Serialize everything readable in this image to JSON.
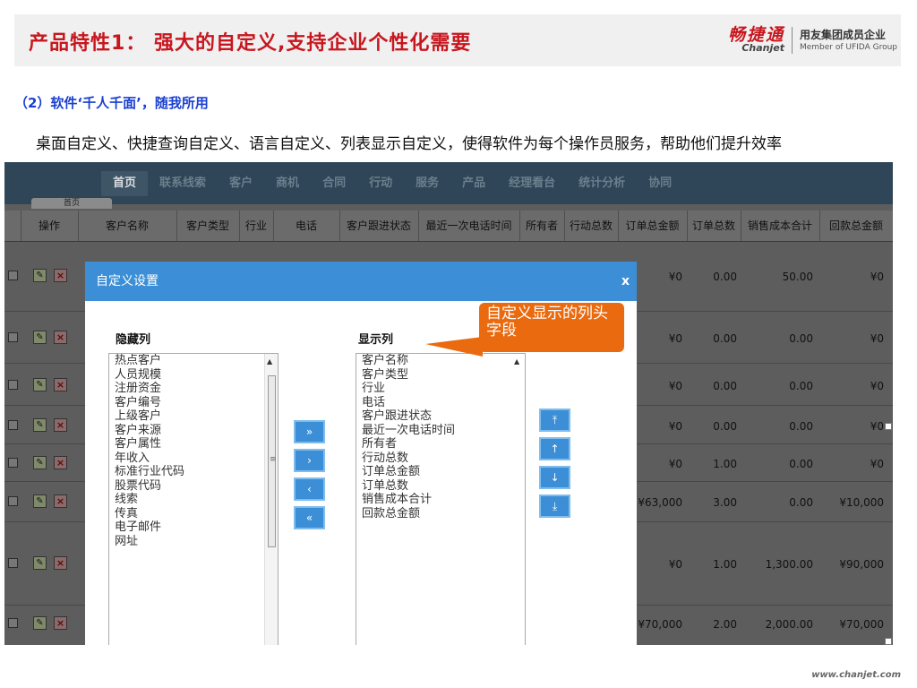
{
  "slide": {
    "title": "产品特性1： 强大的自定义,支持企业个性化需要",
    "subheading": "（2）软件‘千人千面’，随我所用",
    "body": "桌面自定义、快捷查询自定义、语言自定义、列表显示自定义，使得软件为每个操作员服务，帮助他们提升效率",
    "footer_url": "www.chanjet.com"
  },
  "logo": {
    "brand_cn": "畅捷通",
    "brand_en": "Chanjet",
    "group_cn": "用友集团成员企业",
    "group_en": "Member of UFIDA Group"
  },
  "app": {
    "nav_items": [
      "首页",
      "联系线索",
      "客户",
      "商机",
      "合同",
      "行动",
      "服务",
      "产品",
      "经理看台",
      "统计分析",
      "协同"
    ],
    "home_tab": "首页",
    "columns": [
      "操作",
      "客户名称",
      "客户类型",
      "行业",
      "电话",
      "客户跟进状态",
      "最近一次电话时间",
      "所有者",
      "行动总数",
      "订单总金额",
      "订单总数",
      "销售成本合计",
      "回款总金额"
    ],
    "rows": [
      {
        "order_total": "¥0",
        "order_count": "0.00",
        "cost_total": "50.00",
        "payment_total": "¥0"
      },
      {
        "order_total": "¥0",
        "order_count": "0.00",
        "cost_total": "0.00",
        "payment_total": "¥0"
      },
      {
        "order_total": "¥0",
        "order_count": "0.00",
        "cost_total": "0.00",
        "payment_total": "¥0"
      },
      {
        "order_total": "¥0",
        "order_count": "0.00",
        "cost_total": "0.00",
        "payment_total": "¥0"
      },
      {
        "order_total": "¥0",
        "order_count": "1.00",
        "cost_total": "0.00",
        "payment_total": "¥0"
      },
      {
        "order_total": "¥63,000",
        "order_count": "3.00",
        "cost_total": "0.00",
        "payment_total": "¥10,000"
      },
      {
        "order_total": "¥0",
        "order_count": "1.00",
        "cost_total": "1,300.00",
        "payment_total": "¥90,000"
      },
      {
        "order_total": "¥70,000",
        "order_count": "2.00",
        "cost_total": "2,000.00",
        "payment_total": "¥70,000"
      }
    ]
  },
  "dialog": {
    "title": "自定义设置",
    "close": "x",
    "hidden_label": "隐藏列",
    "shown_label": "显示列",
    "hidden_columns": [
      "热点客户",
      "人员规模",
      "注册资金",
      "客户编号",
      "上级客户",
      "客户来源",
      "客户属性",
      "年收入",
      "标准行业代码",
      "股票代码",
      "线索",
      "传真",
      "电子邮件",
      "网址"
    ],
    "shown_columns": [
      "客户名称",
      "客户类型",
      "行业",
      "电话",
      "客户跟进状态",
      "最近一次电话时间",
      "所有者",
      "行动总数",
      "订单总金额",
      "订单总数",
      "销售成本合计",
      "回款总金额"
    ],
    "move_buttons": {
      "all_right": "»",
      "right": "›",
      "left": "‹",
      "all_left": "«"
    },
    "order_buttons": {
      "top": "⤒",
      "up": "↑",
      "down": "↓",
      "bottom": "⤓"
    }
  },
  "callout": {
    "text": "自定义显示的列头字段"
  },
  "colors": {
    "title_red": "#c8161e",
    "heading_blue": "#1a3fd0",
    "dialog_blue": "#3c8fd6",
    "callout_orange": "#ea6a0f"
  }
}
